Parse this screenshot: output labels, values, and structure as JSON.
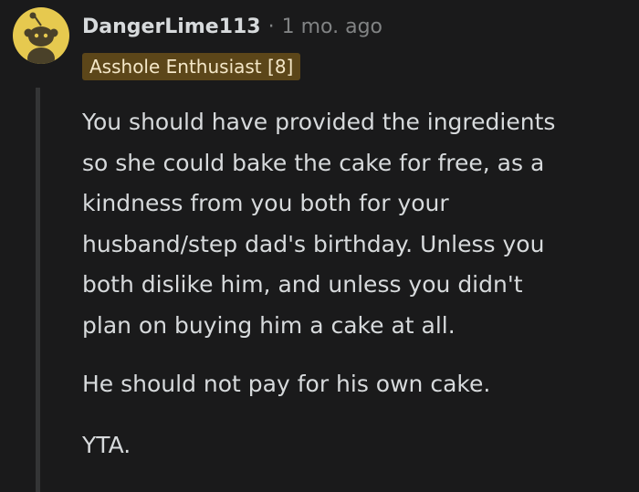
{
  "comment": {
    "avatar_icon": "reddit-snoo-avatar-icon",
    "author": "DangerLime113",
    "separator": "·",
    "timestamp": "1 mo. ago",
    "flair": "Asshole Enthusiast [8]",
    "paragraphs": [
      "You should have provided the ingredients\nso she could bake the cake for free, as a\nkindness from you both for your\nhusband/step dad's birthday. Unless you\nboth dislike him, and unless you didn't\nplan on buying him a cake at all.",
      "He should not pay for his own cake.",
      "YTA."
    ]
  },
  "colors": {
    "background": "#1a1a1b",
    "text": "#d7dadc",
    "meta": "#818384",
    "flair_bg": "#5c4619",
    "flair_text": "#f4e7c8",
    "avatar_bg": "#e6c94f",
    "thread_line": "#343536"
  }
}
